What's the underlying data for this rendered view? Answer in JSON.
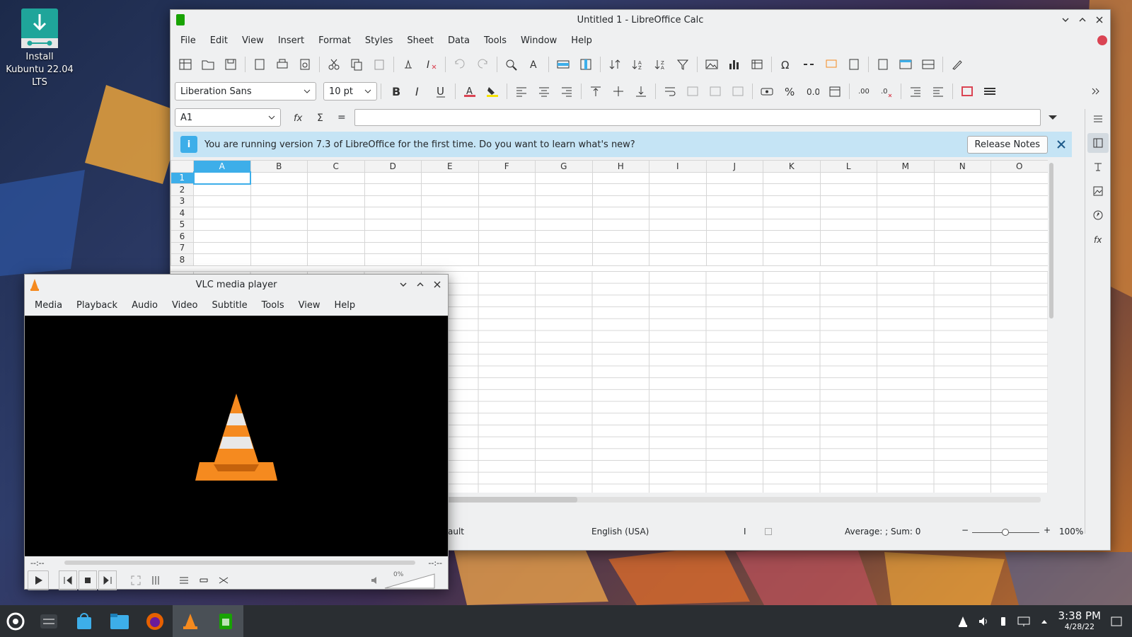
{
  "desktop": {
    "install_icon_label": "Install Kubuntu 22.04 LTS"
  },
  "calc": {
    "title": "Untitled 1 - LibreOffice Calc",
    "menu": [
      "File",
      "Edit",
      "View",
      "Insert",
      "Format",
      "Styles",
      "Sheet",
      "Data",
      "Tools",
      "Window",
      "Help"
    ],
    "font_name": "Liberation Sans",
    "font_size": "10 pt",
    "name_box": "A1",
    "formula_equals": "=",
    "info_message": "You are running version 7.3 of LibreOffice for the first time. Do you want to learn what's new?",
    "release_notes_label": "Release Notes",
    "columns": [
      "A",
      "B",
      "C",
      "D",
      "E",
      "F",
      "G",
      "H",
      "I",
      "J",
      "K",
      "L",
      "M",
      "N",
      "O"
    ],
    "rows": [
      "1",
      "2",
      "3",
      "4",
      "5",
      "6",
      "7",
      "8"
    ],
    "status": {
      "page_style": "Default",
      "language": "English (USA)",
      "summary": "Average: ; Sum: 0",
      "zoom": "100%"
    }
  },
  "vlc": {
    "title": "VLC media player",
    "menu": [
      "Media",
      "Playback",
      "Audio",
      "Video",
      "Subtitle",
      "Tools",
      "View",
      "Help"
    ],
    "time_elapsed": "--:--",
    "time_total": "--:--",
    "volume": "0%"
  },
  "taskbar": {
    "time": "3:38 PM",
    "date": "4/28/22"
  },
  "colors": {
    "accent": "#3daee9",
    "calc_green": "#18a303",
    "vlc_orange": "#f58a1f",
    "info_bg": "#c5e4f5"
  }
}
